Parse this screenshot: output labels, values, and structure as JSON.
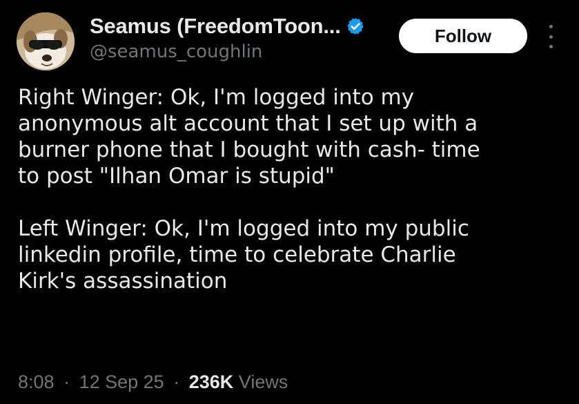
{
  "author": {
    "display_name": "Seamus (FreedomToon...",
    "handle": "@seamus_coughlin",
    "avatar_icon": "dog-with-sunglasses-avatar",
    "verified_icon": "verified-badge-icon",
    "verified_color": "#1d9bf0"
  },
  "actions": {
    "follow_label": "Follow",
    "more_icon": "more-options-icon"
  },
  "tweet": {
    "paragraph_1": "Right Winger: Ok, I'm logged into my\nanonymous alt account that I set up with a\nburner phone that I bought with cash- time\nto post \"Ilhan Omar is stupid\"",
    "paragraph_2": "Left Winger: Ok, I'm logged into my public\nlinkedin profile, time to celebrate Charlie\nKirk's assassination"
  },
  "meta": {
    "time": "8:08",
    "separator": "·",
    "date": "12 Sep 25",
    "views_count": "236K",
    "views_label": "Views"
  },
  "colors": {
    "background": "#000000",
    "text_primary": "#e7e9ea",
    "text_secondary": "#71767b",
    "follow_bg": "#ffffff"
  }
}
